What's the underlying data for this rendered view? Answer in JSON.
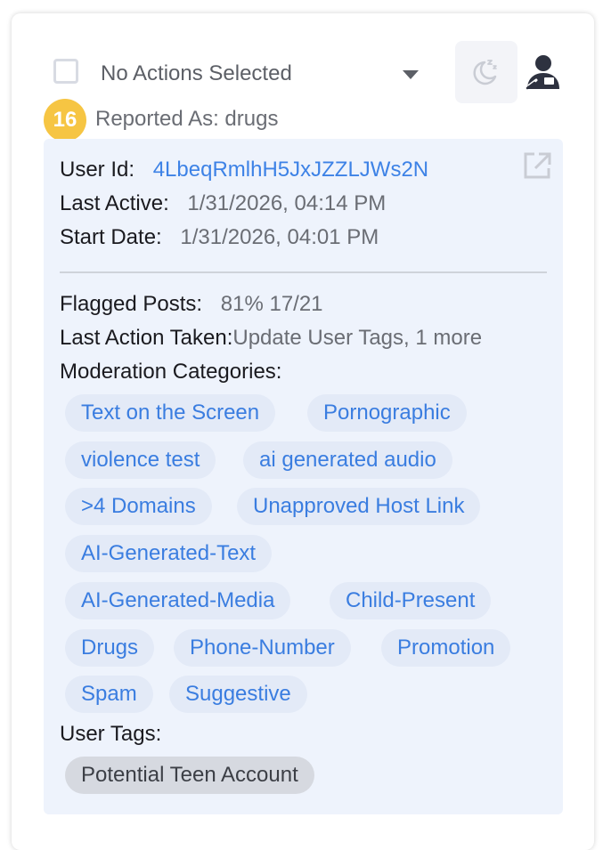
{
  "actions": {
    "selected_label": "No Actions Selected"
  },
  "report": {
    "count": "16",
    "reported_as": "Reported As: drugs"
  },
  "user": {
    "id_label": "User Id:",
    "id_value": "4LbeqRmlhH5JxJZZLJWs2N",
    "last_active_label": "Last Active:",
    "last_active_value": "1/31/2026, 04:14 PM",
    "start_date_label": "Start Date:",
    "start_date_value": "1/31/2026, 04:01 PM"
  },
  "stats": {
    "flagged_label": "Flagged Posts:",
    "flagged_value": "81% 17/21",
    "last_action_label": "Last Action Taken:",
    "last_action_value": "Update User Tags, 1 more",
    "categories_label": "Moderation Categories:",
    "user_tags_label": "User Tags:"
  },
  "categories": [
    "Text on the Screen",
    "Pornographic",
    "violence test",
    "ai generated audio",
    ">4 Domains",
    "Unapproved Host Link",
    "AI-Generated-Text",
    "AI-Generated-Media",
    "Child-Present",
    "Drugs",
    "Phone-Number",
    "Promotion",
    "Spam",
    "Suggestive"
  ],
  "user_tags": [
    "Potential Teen Account"
  ],
  "colors": {
    "accent": "#3d82e6",
    "badge": "#f6c543",
    "panel": "#eef3fc",
    "chip": "#e3eaf7",
    "tag_chip": "#d6d9e0"
  },
  "icons": {
    "snooze": "snooze-moon-icon",
    "profile": "user-profile-icon",
    "open": "open-external-icon",
    "caret": "caret-down-icon"
  }
}
